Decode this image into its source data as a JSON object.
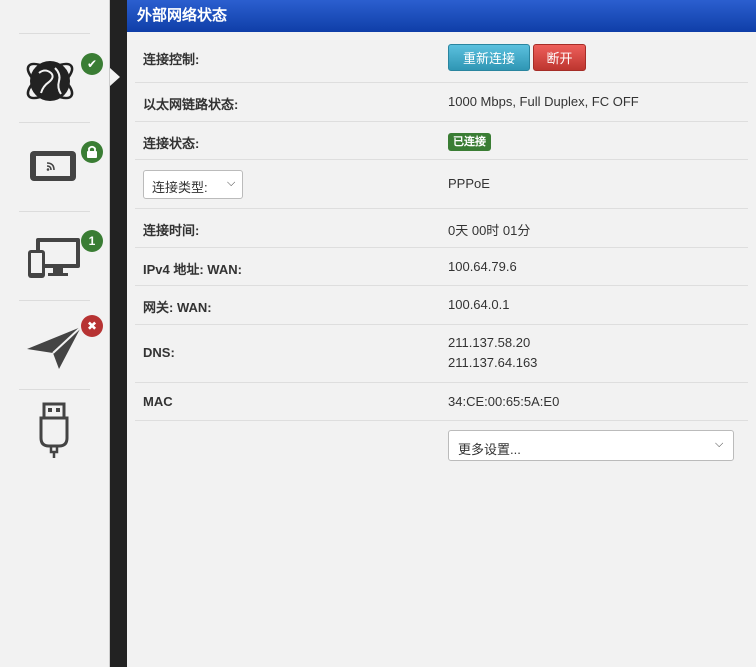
{
  "sidebar": {
    "items": [
      {
        "icon": "globe-icon",
        "badge_icon": "check-icon",
        "badge_text": "✔"
      },
      {
        "icon": "wireless-device-icon",
        "badge_icon": "lock-icon",
        "badge_text": ""
      },
      {
        "icon": "devices-icon",
        "badge_icon": "count-badge",
        "badge_text": "1"
      },
      {
        "icon": "paper-plane-icon",
        "badge_icon": "x-icon",
        "badge_text": "✖"
      },
      {
        "icon": "usb-icon",
        "badge_icon": "",
        "badge_text": ""
      }
    ]
  },
  "panel": {
    "title": "外部网络状态",
    "connection_control_label": "连接控制:",
    "reconnect_label": "重新连接",
    "disconnect_label": "断开",
    "link_status_label": "以太网链路状态:",
    "link_status_value": "1000 Mbps, Full Duplex, FC OFF",
    "connection_state_label": "连接状态:",
    "connection_state_value": "已连接",
    "connection_type_select": "连接类型:",
    "connection_type_value": "PPPoE",
    "connection_time_label": "连接时间:",
    "connection_time_value": "0天 00时 01分",
    "ipv4_label": "IPv4 地址: WAN:",
    "ipv4_value": "100.64.79.6",
    "gateway_label": "网关: WAN:",
    "gateway_value": "100.64.0.1",
    "dns_label": "DNS:",
    "dns_values": [
      "211.137.58.20",
      "211.137.64.163"
    ],
    "mac_label": "MAC",
    "mac_value": "34:CE:00:65:5A:E0",
    "more_settings_select": "更多设置..."
  },
  "colors": {
    "header_blue": "#1a4fc0",
    "success_green": "#3a7d34",
    "danger_red": "#bd362f",
    "info_blue": "#2f96b4"
  }
}
